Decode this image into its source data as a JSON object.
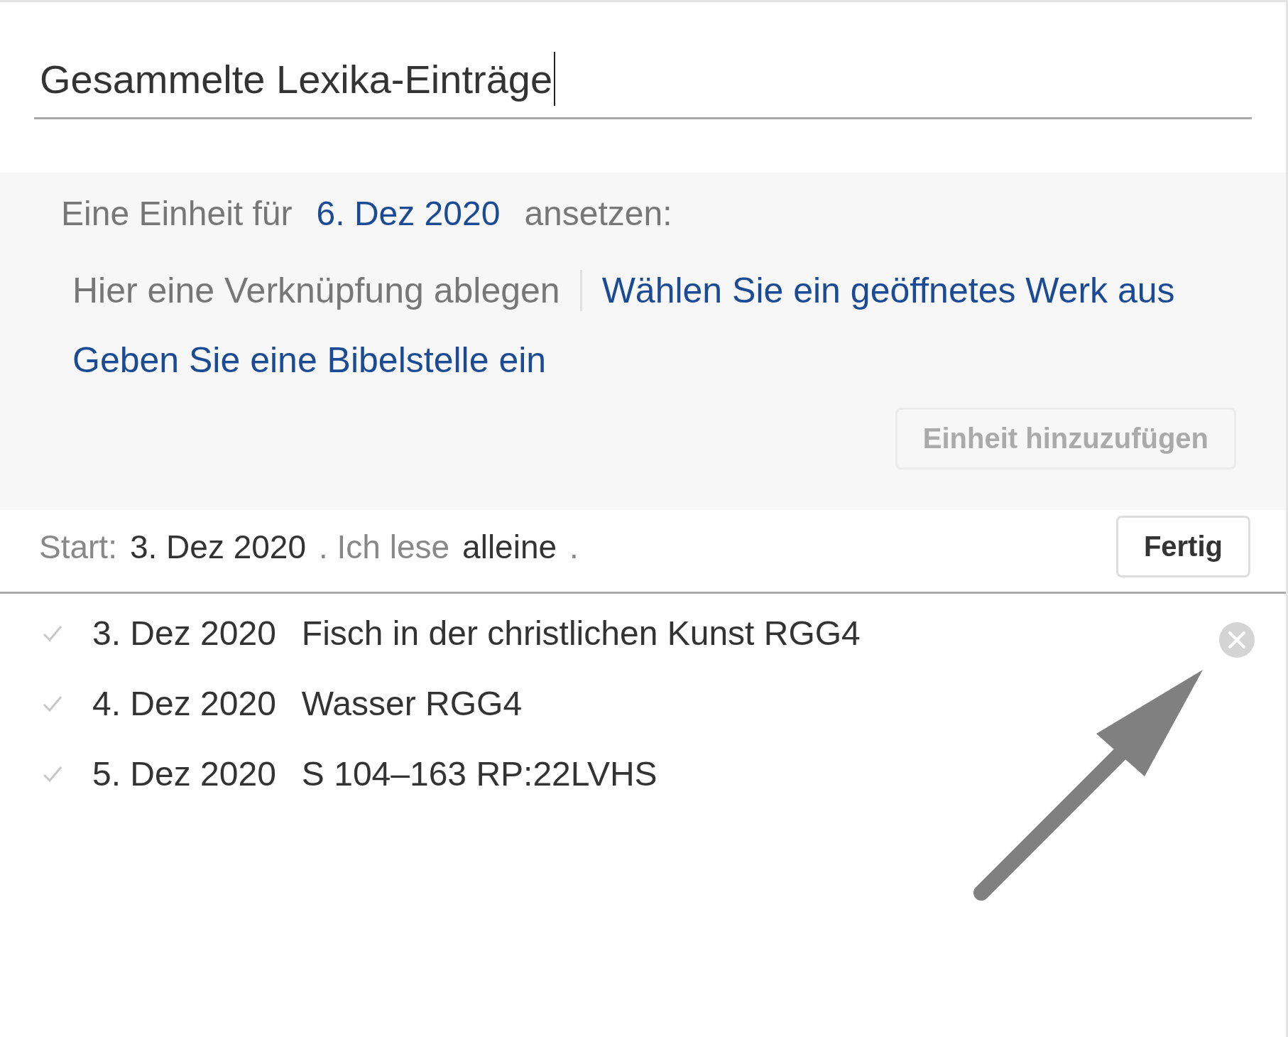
{
  "title_field": {
    "value": "Gesammelte Lexika-Einträge",
    "focused": true
  },
  "schedule_panel": {
    "prompt_label": "Eine Einheit für",
    "date_link": "6. Dez 2020",
    "prompt_suffix": "ansetzen:",
    "sources": [
      {
        "label": "Hier eine Verknüpfung ablegen",
        "kind": "hint"
      },
      {
        "label": "Wählen Sie ein geöffnetes Werk aus",
        "kind": "link"
      },
      {
        "label": "Geben Sie eine Bibelstelle ein",
        "kind": "link"
      }
    ],
    "add_button": {
      "label": "Einheit hinzuzufügen",
      "disabled": true
    }
  },
  "start_line": {
    "label": "Start:",
    "date": "3. Dez 2020",
    "reader_label": ". Ich lese",
    "reader": "alleine",
    "end": "."
  },
  "done_button": {
    "label": "Fertig"
  },
  "entries": [
    {
      "checked": true,
      "date": "3. Dez 2020",
      "title": "Fisch in der christlichen Kunst RGG4"
    },
    {
      "checked": true,
      "date": "4. Dez 2020",
      "title": "Wasser RGG4"
    },
    {
      "checked": true,
      "date": "5. Dez 2020",
      "title": "S 104–163 RP:22LVHS"
    }
  ]
}
